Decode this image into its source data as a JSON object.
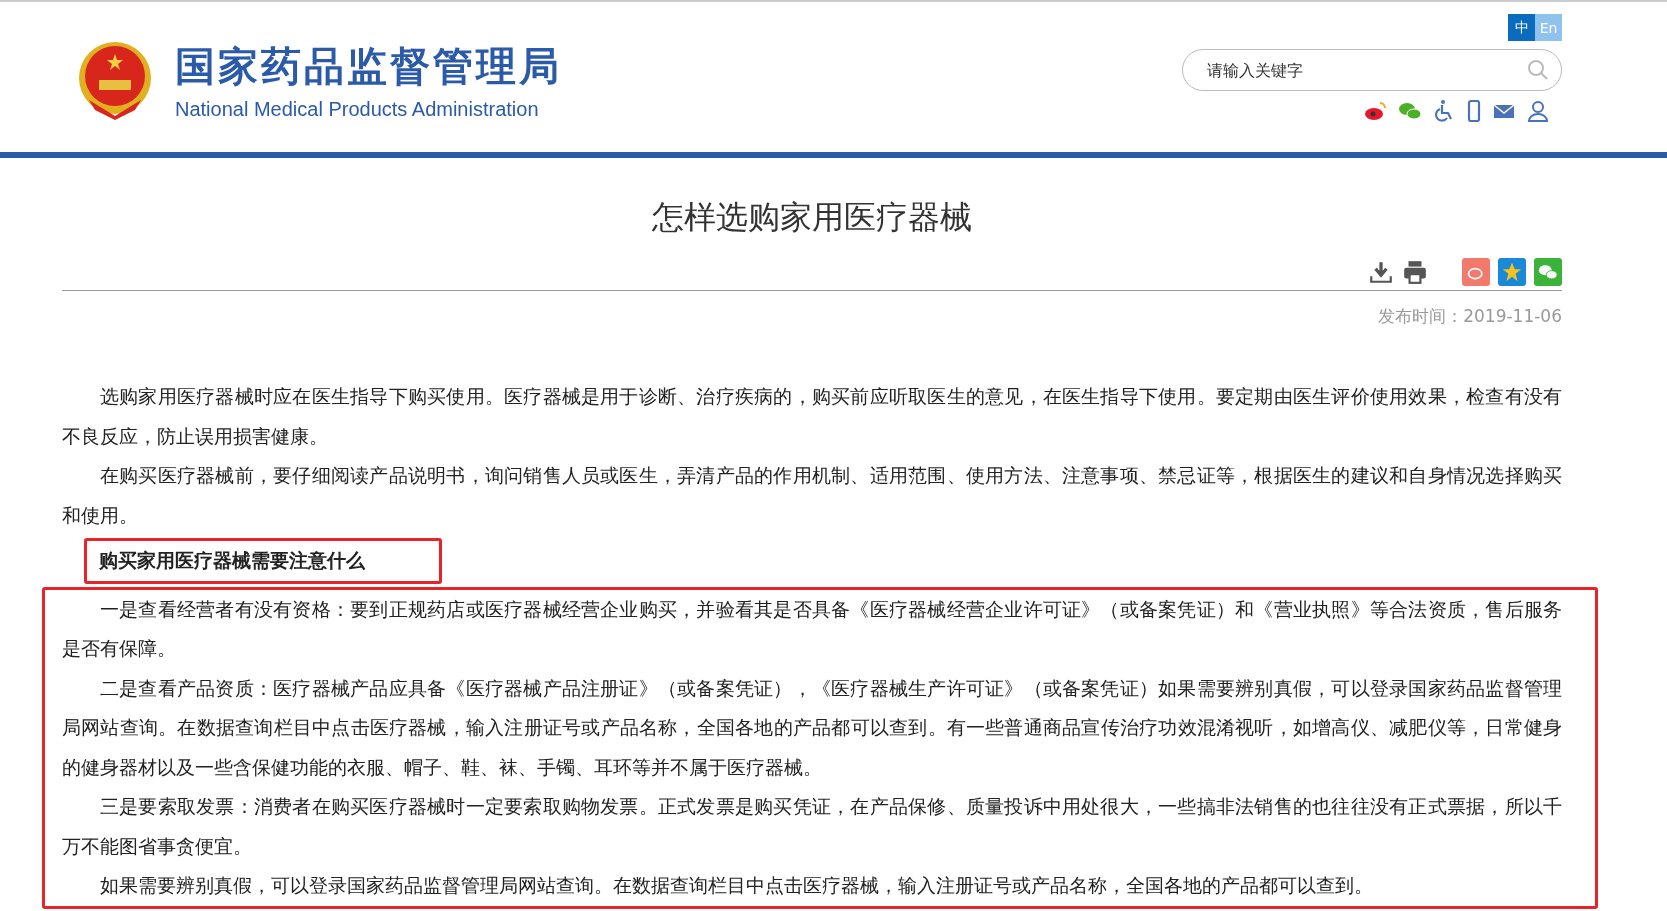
{
  "header": {
    "title": "国家药品监督管理局",
    "subtitle": "National Medical Products Administration",
    "languages": [
      {
        "label": "中",
        "selected": true
      },
      {
        "label": "En",
        "selected": false
      }
    ],
    "search": {
      "placeholder": "请输入关键字"
    }
  },
  "article": {
    "title": "怎样选购家用医疗器械",
    "date": "发布时间：2019-11-06",
    "blocks": [
      {
        "highlighted": false,
        "kind": "body",
        "paragraphs": [
          "选购家用医疗器械时应在医生指导下购买使用。医疗器械是用于诊断、治疗疾病的，购买前应听取医生的意见，在医生指导下使用。要定期由医生评价使用效果，检查有没有不良反应，防止误用损害健康。",
          "在购买医疗器械前，要仔细阅读产品说明书，询问销售人员或医生，弄清产品的作用机制、适用范围、使用方法、注意事项、禁忌证等，根据医生的建议和自身情况选择购买和使用。"
        ]
      },
      {
        "highlighted": true,
        "kind": "heading",
        "paragraphs": [
          "购买家用医疗器械需要注意什么"
        ]
      },
      {
        "highlighted": true,
        "kind": "body",
        "paragraphs": [
          "一是查看经营者有没有资格：要到正规药店或医疗器械经营企业购买，并验看其是否具备《医疗器械经营企业许可证》（或备案凭证）和《营业执照》等合法资质，售后服务是否有保障。",
          "二是查看产品资质：医疗器械产品应具备《医疗器械产品注册证》（或备案凭证），《医疗器械生产许可证》（或备案凭证）如果需要辨别真假，可以登录国家药品监督管理局网站查询。在数据查询栏目中点击医疗器械，输入注册证号或产品名称，全国各地的产品都可以查到。有一些普通商品宣传治疗功效混淆视听，如增高仪、减肥仪等，日常健身的健身器材以及一些含保健功能的衣服、帽子、鞋、袜、手镯、耳环等并不属于医疗器械。",
          "三是要索取发票：消费者在购买医疗器械时一定要索取购物发票。正式发票是购买凭证，在产品保修、质量投诉中用处很大，一些搞非法销售的也往往没有正式票据，所以千万不能图省事贪便宜。",
          "如果需要辨别真假，可以登录国家药品监督管理局网站查询。在数据查询栏目中点击医疗器械，输入注册证号或产品名称，全国各地的产品都可以查到。"
        ]
      }
    ]
  }
}
